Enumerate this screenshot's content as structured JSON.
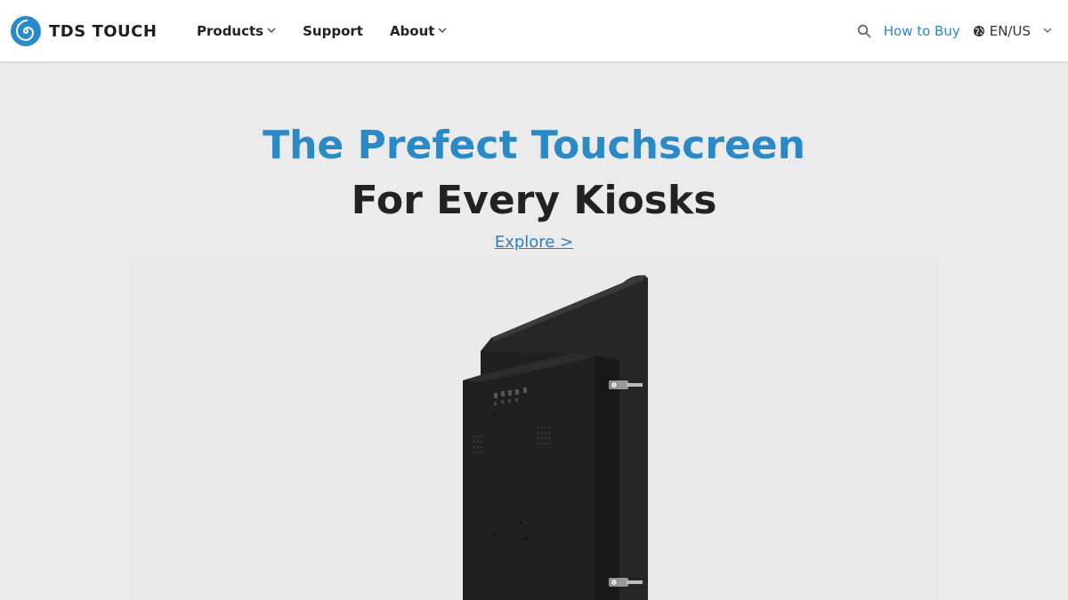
{
  "header": {
    "brand": "TDS TOUCH",
    "logo_icon": "spiral-logo-icon",
    "nav": [
      {
        "label": "Products",
        "has_dropdown": true
      },
      {
        "label": "Support",
        "has_dropdown": false
      },
      {
        "label": "About",
        "has_dropdown": true
      }
    ],
    "search_icon": "search-icon",
    "how_to_buy": "How to Buy",
    "language": "EN/US",
    "globe_icon": "globe-icon"
  },
  "hero": {
    "headline_line1": "The Prefect Touchscreen",
    "headline_line2": "For Every Kiosks",
    "cta": "Explore >",
    "image_subject": "touchscreen-monitor-rear-view"
  },
  "colors": {
    "accent": "#2a8ac8",
    "link": "#2a7fc2",
    "background": "#ebebeb",
    "header_bg": "#ffffff",
    "text_dark": "#222222"
  }
}
